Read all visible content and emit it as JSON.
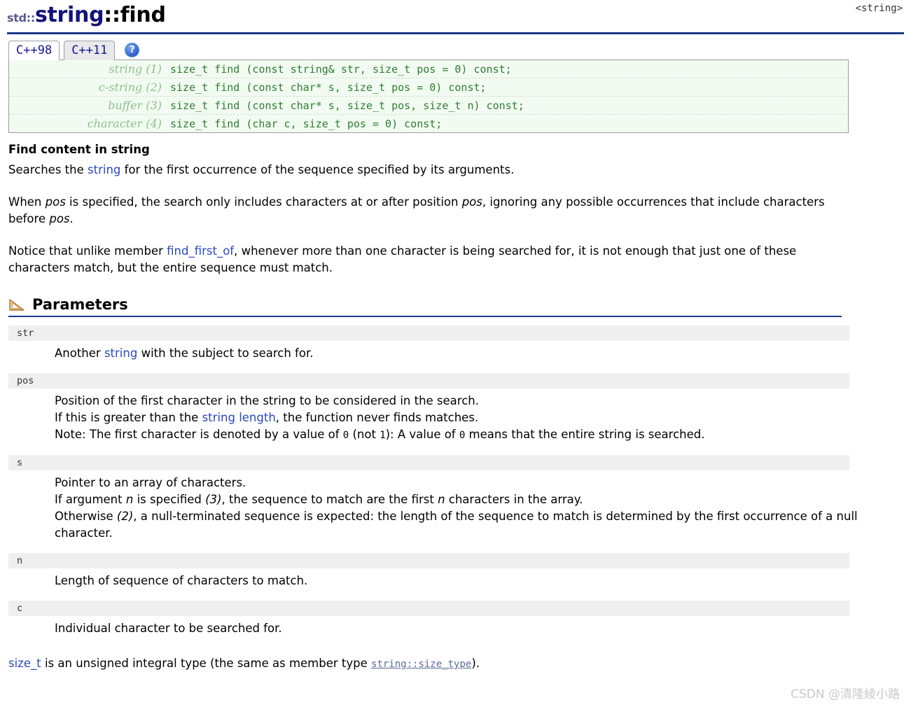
{
  "header": {
    "namespace": "std::",
    "class_name": "string",
    "separator": "::",
    "function_name": "find",
    "include": "<string>"
  },
  "tabs": [
    {
      "label": "C++98",
      "active": true
    },
    {
      "label": "C++11",
      "active": false
    }
  ],
  "help_icon_label": "?",
  "signatures": [
    {
      "label": "string (1)",
      "code": "size_t find (const string& str, size_t pos = 0) const;"
    },
    {
      "label": "c-string (2)",
      "code": "size_t find (const char* s, size_t pos = 0) const;"
    },
    {
      "label": "buffer (3)",
      "code": "size_t find (const char* s, size_t pos, size_t n) const;"
    },
    {
      "label": "character (4)",
      "code": "size_t find (char c, size_t pos = 0) const;"
    }
  ],
  "description": {
    "subheading": "Find content in string",
    "p1_before": "Searches the ",
    "p1_link": "string",
    "p1_after": " for the first occurrence of the sequence specified by its arguments.",
    "p2_a": "When ",
    "p2_pos1": "pos",
    "p2_b": " is specified, the search only includes characters at or after position ",
    "p2_pos2": "pos",
    "p2_c": ", ignoring any possible occurrences that include characters before ",
    "p2_pos3": "pos",
    "p2_d": ".",
    "p3_a": "Notice that unlike member ",
    "p3_link": "find_first_of",
    "p3_b": ", whenever more than one character is being searched for, it is not enough that just one of these characters match, but the entire sequence must match."
  },
  "parameters_section": {
    "title": "Parameters",
    "icon": "ruler-triangle-icon"
  },
  "parameters": [
    {
      "name": "str",
      "lines": [
        {
          "parts": [
            {
              "t": "text",
              "v": "Another "
            },
            {
              "t": "link",
              "v": "string"
            },
            {
              "t": "text",
              "v": " with the subject to search for."
            }
          ]
        }
      ]
    },
    {
      "name": "pos",
      "lines": [
        {
          "parts": [
            {
              "t": "text",
              "v": "Position of the first character in the string to be considered in the search."
            }
          ]
        },
        {
          "parts": [
            {
              "t": "text",
              "v": "If this is greater than the "
            },
            {
              "t": "link",
              "v": "string length"
            },
            {
              "t": "text",
              "v": ", the function never finds matches."
            }
          ]
        },
        {
          "parts": [
            {
              "t": "text",
              "v": "Note: The first character is denoted by a value of "
            },
            {
              "t": "mono",
              "v": "0"
            },
            {
              "t": "text",
              "v": " (not "
            },
            {
              "t": "mono",
              "v": "1"
            },
            {
              "t": "text",
              "v": "): A value of "
            },
            {
              "t": "mono",
              "v": "0"
            },
            {
              "t": "text",
              "v": " means that the entire string is searched."
            }
          ]
        }
      ]
    },
    {
      "name": "s",
      "lines": [
        {
          "parts": [
            {
              "t": "text",
              "v": "Pointer to an array of characters."
            }
          ]
        },
        {
          "parts": [
            {
              "t": "text",
              "v": "If argument "
            },
            {
              "t": "ital",
              "v": "n"
            },
            {
              "t": "text",
              "v": " is specified "
            },
            {
              "t": "ital",
              "v": "(3)"
            },
            {
              "t": "text",
              "v": ", the sequence to match are the first "
            },
            {
              "t": "ital",
              "v": "n"
            },
            {
              "t": "text",
              "v": " characters in the array."
            }
          ]
        },
        {
          "parts": [
            {
              "t": "text",
              "v": "Otherwise "
            },
            {
              "t": "ital",
              "v": "(2)"
            },
            {
              "t": "text",
              "v": ", a null-terminated sequence is expected: the length of the sequence to match is determined by the first occurrence of a null character."
            }
          ]
        }
      ]
    },
    {
      "name": "n",
      "lines": [
        {
          "parts": [
            {
              "t": "text",
              "v": "Length of sequence of characters to match."
            }
          ]
        }
      ]
    },
    {
      "name": "c",
      "lines": [
        {
          "parts": [
            {
              "t": "text",
              "v": "Individual character to be searched for."
            }
          ]
        }
      ]
    }
  ],
  "footnote": {
    "link": "size_t",
    "mid": " is an unsigned integral type (the same as member type ",
    "mono_link": "string::size_type",
    "end": ")."
  },
  "watermark": "CSDN @清隆綾小路",
  "colors": {
    "title_class": "#12137a",
    "namespace": "#5a5a8c",
    "rule": "#1b3a86",
    "link": "#2a48bf",
    "sig_code": "#2f7d32",
    "sig_label": "#8fbf8f",
    "sig_bg": "#f2fbf1",
    "param_bar": "#efefef",
    "watermark": "#c9c9c9"
  }
}
